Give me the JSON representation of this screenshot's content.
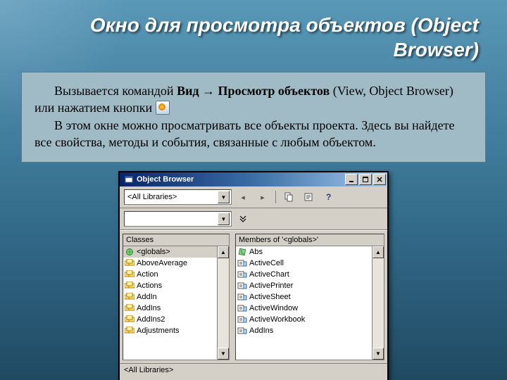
{
  "slide": {
    "title": "Окно для просмотра объектов (Object Browser)",
    "para1_a": "Вызывается командой ",
    "para1_b": "Вид → Просмотр объектов",
    "para1_c": " (View, Object Browser) или нажатием кнопки ",
    "para2": "В этом окне можно просматривать все объекты проекта. Здесь вы найдете все свойства, методы и события, связанные с любым объектом."
  },
  "window": {
    "title": "Object Browser",
    "libraries_combo": "<All Libraries>",
    "search_combo": "",
    "classes_header": "Classes",
    "members_header": "Members of '<globals>'",
    "desc_text": "<All Libraries>",
    "classes": [
      {
        "label": "<globals>",
        "icon": "globals",
        "selected": true
      },
      {
        "label": "AboveAverage",
        "icon": "class"
      },
      {
        "label": "Action",
        "icon": "class"
      },
      {
        "label": "Actions",
        "icon": "class"
      },
      {
        "label": "AddIn",
        "icon": "class"
      },
      {
        "label": "AddIns",
        "icon": "class"
      },
      {
        "label": "AddIns2",
        "icon": "class"
      },
      {
        "label": "Adjustments",
        "icon": "class"
      }
    ],
    "members": [
      {
        "label": "Abs",
        "icon": "method"
      },
      {
        "label": "ActiveCell",
        "icon": "prop"
      },
      {
        "label": "ActiveChart",
        "icon": "prop"
      },
      {
        "label": "ActivePrinter",
        "icon": "prop"
      },
      {
        "label": "ActiveSheet",
        "icon": "prop"
      },
      {
        "label": "ActiveWindow",
        "icon": "prop"
      },
      {
        "label": "ActiveWorkbook",
        "icon": "prop"
      },
      {
        "label": "AddIns",
        "icon": "prop"
      }
    ]
  }
}
